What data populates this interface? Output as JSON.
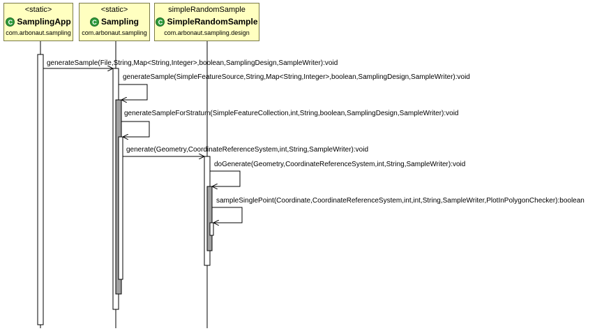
{
  "lifelines": [
    {
      "stereotype": "<static>",
      "name": "SamplingApp",
      "package": "com.arbonaut.sampling",
      "icon": "class-icon"
    },
    {
      "stereotype": "<static>",
      "name": "Sampling",
      "package": "com.arbonaut.sampling",
      "icon": "class-icon"
    },
    {
      "stereotype": "simpleRandomSample",
      "name": "SimpleRandomSample",
      "package": "com.arbonaut.sampling.design",
      "icon": "class-icon"
    }
  ],
  "messages": [
    "generateSample(File,String,Map<String,Integer>,boolean,SamplingDesign,SampleWriter):void",
    "generateSample(SimpleFeatureSource,String,Map<String,Integer>,boolean,SamplingDesign,SampleWriter):void",
    "generateSampleForStratum(SimpleFeatureCollection,int,String,boolean,SamplingDesign,SampleWriter):void",
    "generate(Geometry,CoordinateReferenceSystem,int,String,SampleWriter):void",
    "doGenerate(Geometry,CoordinateReferenceSystem,int,String,SampleWriter):void",
    "sampleSinglePoint(Coordinate,CoordinateReferenceSystem,int,int,String,SampleWriter,PlotInPolygonChecker):boolean"
  ],
  "colors": {
    "header_fill": "#ffffc0",
    "header_border": "#7a7a48",
    "icon_green": "#2f9a3a",
    "activation_fill": "#ffffff",
    "nested_activation_fill": "#a0a0a0",
    "line": "#000000"
  }
}
